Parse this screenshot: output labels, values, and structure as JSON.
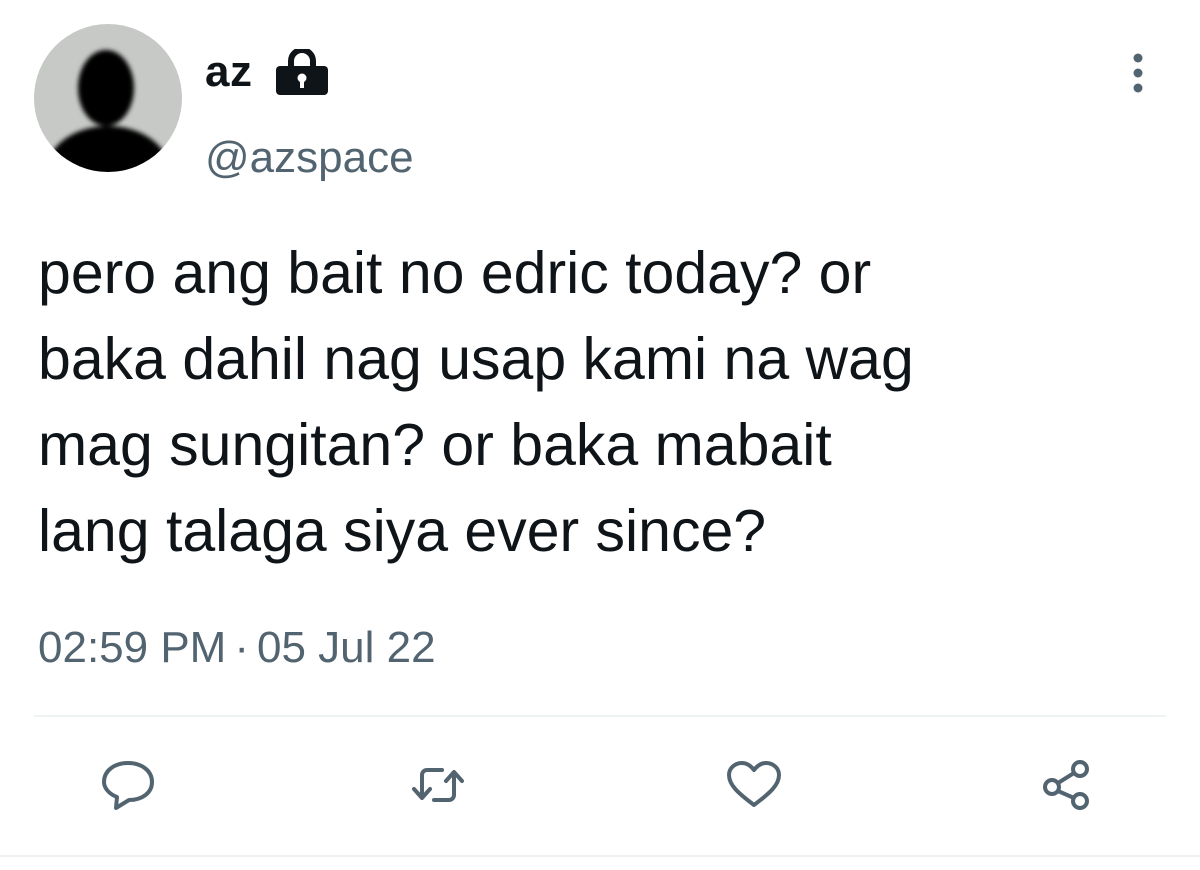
{
  "tweet": {
    "author": {
      "display_name": "az",
      "handle": "@azspace",
      "protected": true,
      "avatar_icon": "default-profile-silhouette"
    },
    "text": "pero ang bait no edric today? or\nbaka dahil nag usap kami na wag\nmag sungitan? or baka mabait\nlang talaga siya ever since?",
    "time": "02:59 PM",
    "separator": "·",
    "date": "05 Jul 22",
    "more_icon": "more-vertical-icon"
  },
  "actions": [
    {
      "name": "reply",
      "icon": "reply-icon"
    },
    {
      "name": "retweet",
      "icon": "retweet-icon"
    },
    {
      "name": "like",
      "icon": "heart-icon"
    },
    {
      "name": "share",
      "icon": "share-icon"
    }
  ],
  "colors": {
    "text_primary": "#0f1419",
    "text_secondary": "#536471",
    "icon": "#536471",
    "divider": "#eff3f4",
    "avatar_bg": "#c6c9c6"
  }
}
